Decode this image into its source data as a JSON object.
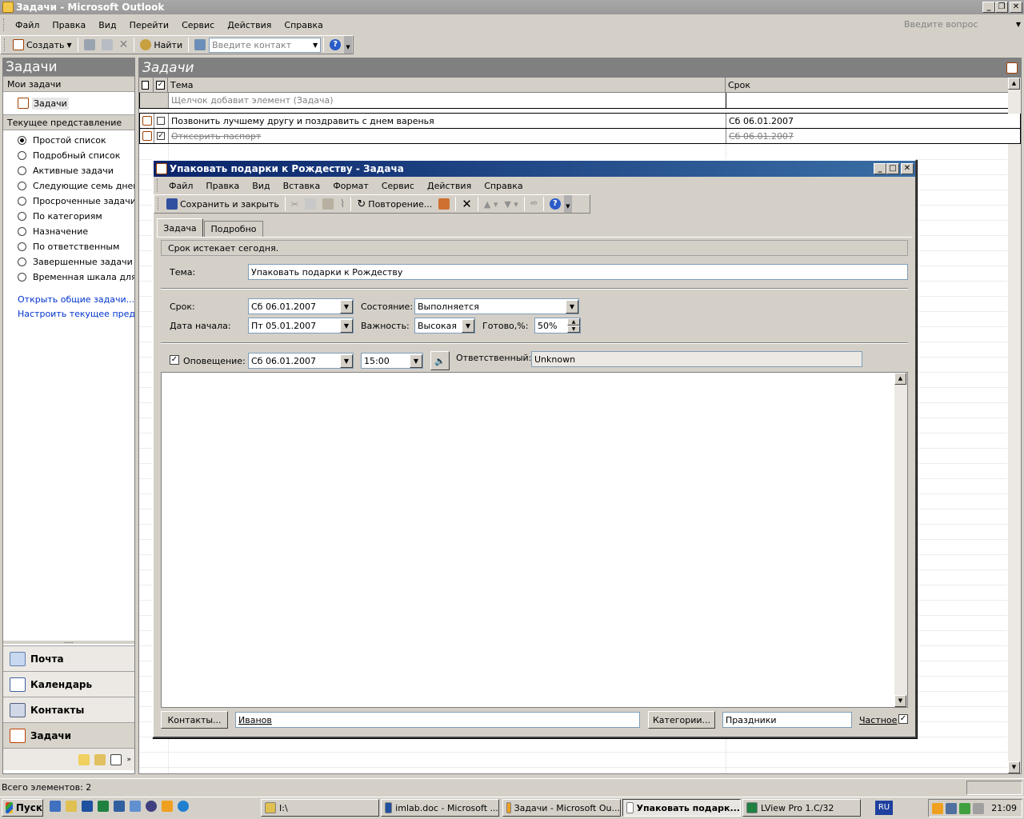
{
  "window": {
    "title": "Задачи - Microsoft Outlook"
  },
  "menu": [
    "Файл",
    "Правка",
    "Вид",
    "Перейти",
    "Сервис",
    "Действия",
    "Справка"
  ],
  "help_search": {
    "placeholder": "Введите вопрос"
  },
  "toolbar": {
    "new_label": "Создать",
    "find_label": "Найти",
    "contact_placeholder": "Введите контакт"
  },
  "nav": {
    "header": "Задачи",
    "my_tasks_header": "Мои задачи",
    "tasks_folder": "Задачи",
    "current_view_header": "Текущее представление",
    "views": [
      {
        "label": "Простой список",
        "selected": true
      },
      {
        "label": "Подробный список",
        "selected": false
      },
      {
        "label": "Активные задачи",
        "selected": false
      },
      {
        "label": "Следующие семь дней",
        "selected": false
      },
      {
        "label": "Просроченные задачи",
        "selected": false
      },
      {
        "label": "По категориям",
        "selected": false
      },
      {
        "label": "Назначение",
        "selected": false
      },
      {
        "label": "По ответственным",
        "selected": false
      },
      {
        "label": "Завершенные задачи",
        "selected": false
      },
      {
        "label": "Временная шкала для задач",
        "selected": false
      }
    ],
    "links": [
      "Открыть общие задачи...",
      "Настроить текущее представление..."
    ],
    "buttons": [
      "Почта",
      "Календарь",
      "Контакты",
      "Задачи"
    ]
  },
  "list": {
    "header": "Задачи",
    "col_subject": "Тема",
    "col_due": "Срок",
    "new_item_placeholder": "Щелчок добавит элемент (Задача)",
    "rows": [
      {
        "subject": "Позвонить лучшему другу и поздравить с днем варенья",
        "due": "Сб 06.01.2007",
        "done": false
      },
      {
        "subject": "Отксерить паспорт",
        "due": "Сб 06.01.2007",
        "done": true
      }
    ]
  },
  "dialog": {
    "title": "Упаковать подарки к Рождеству - Задача",
    "menu": [
      "Файл",
      "Правка",
      "Вид",
      "Вставка",
      "Формат",
      "Сервис",
      "Действия",
      "Справка"
    ],
    "save_close": "Сохранить и закрыть",
    "recurrence": "Повторение...",
    "tabs": [
      "Задача",
      "Подробно"
    ],
    "info_bar": "Срок истекает сегодня.",
    "subject_label": "Тема:",
    "subject": "Упаковать подарки к Рождеству",
    "due_label": "Срок:",
    "due": "Сб 06.01.2007",
    "start_label": "Дата начала:",
    "start": "Пт 05.01.2007",
    "status_label": "Состояние:",
    "status": "Выполняется",
    "priority_label": "Важность:",
    "priority": "Высокая",
    "done_label": "Готово,%:",
    "done_pct": "50%",
    "reminder_label": "Оповещение:",
    "reminder_checked": true,
    "reminder_date": "Сб 06.01.2007",
    "reminder_time": "15:00",
    "owner_label": "Ответственный:",
    "owner": "Unknown",
    "contacts_btn": "Контакты...",
    "contacts": "Иванов",
    "categories_btn": "Категории...",
    "categories": "Праздники",
    "private_label": "Частное",
    "private_checked": true
  },
  "statusbar": {
    "text": "Всего элементов: 2"
  },
  "taskbar": {
    "start": "Пуск",
    "items": [
      {
        "label": "I:\\",
        "active": false
      },
      {
        "label": "imlab.doc - Microsoft ...",
        "active": false
      },
      {
        "label": "Задачи - Microsoft Ou...",
        "active": false
      },
      {
        "label": "Упаковать подарк...",
        "active": true
      },
      {
        "label": "LView Pro 1.C/32",
        "active": false
      }
    ],
    "lang": "RU",
    "clock": "21:09"
  }
}
